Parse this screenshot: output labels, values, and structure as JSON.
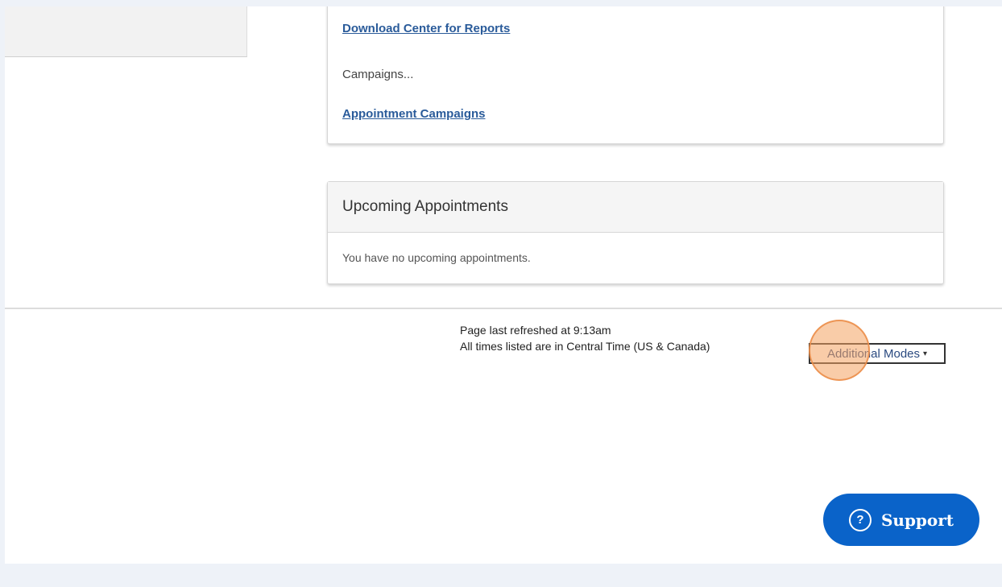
{
  "links": {
    "download_center": "Download Center for Reports",
    "campaigns_label": "Campaigns...",
    "appointment_campaigns": "Appointment Campaigns"
  },
  "appointments": {
    "title": "Upcoming Appointments",
    "empty_message": "You have no upcoming appointments."
  },
  "footer": {
    "refreshed": "Page last refreshed at 9:13am",
    "timezone": "All times listed are in Central Time (US & Canada)",
    "modes_label": "Additional Modes",
    "modes_caret": "▾"
  },
  "support": {
    "icon": "?",
    "label": "Support"
  },
  "colors": {
    "link": "#2a5b9a",
    "support_bg": "#0a63c9",
    "click_marker": "#f4a261"
  }
}
